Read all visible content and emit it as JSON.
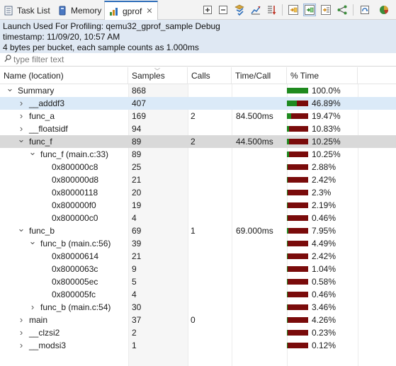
{
  "tabs": [
    {
      "label": "Task List",
      "icon": "task-list-icon",
      "active": false
    },
    {
      "label": "Memory",
      "icon": "memory-icon",
      "active": false
    },
    {
      "label": "gprof",
      "icon": "gprof-icon",
      "active": true
    }
  ],
  "toolbar": {
    "buttons": [
      "expand-all-icon",
      "collapse-all-icon",
      "filter-icon",
      "export-chart-icon",
      "sort-icon",
      "view-by-file-icon",
      "view-by-function-icon",
      "view-by-line-icon",
      "call-graph-icon",
      "switch-sample-icon",
      "chart-icon"
    ]
  },
  "info": {
    "line1": "Launch Used For Profiling: qemu32_gprof_sample Debug",
    "line2": "timestamp: 11/09/20, 10:57 AM",
    "line3": "4 bytes per bucket, each sample counts as 1.000ms"
  },
  "filter": {
    "placeholder": "type filter text"
  },
  "columns": {
    "name": "Name (location)",
    "samples": "Samples",
    "calls": "Calls",
    "time": "Time/Call",
    "pct": "% Time"
  },
  "colors": {
    "bar_green": "#1f8a1f",
    "bar_red": "#7a0b0b",
    "info_bg": "#dfe8f3"
  },
  "rows": [
    {
      "name": "Summary",
      "samples": "868",
      "calls": "",
      "time": "",
      "pct": "100.0%",
      "fraction": 1.0,
      "level": 0,
      "twisty": "open"
    },
    {
      "name": "__adddf3",
      "samples": "407",
      "calls": "",
      "time": "",
      "pct": "46.89%",
      "fraction": 0.4689,
      "level": 1,
      "twisty": "closed",
      "highlight": "blue"
    },
    {
      "name": "func_a",
      "samples": "169",
      "calls": "2",
      "time": "84.500ms",
      "pct": "19.47%",
      "fraction": 0.1947,
      "level": 1,
      "twisty": "closed"
    },
    {
      "name": "__floatsidf",
      "samples": "94",
      "calls": "",
      "time": "",
      "pct": "10.83%",
      "fraction": 0.1083,
      "level": 1,
      "twisty": "closed"
    },
    {
      "name": "func_f",
      "samples": "89",
      "calls": "2",
      "time": "44.500ms",
      "pct": "10.25%",
      "fraction": 0.1025,
      "level": 1,
      "twisty": "open",
      "highlight": "grey"
    },
    {
      "name": "func_f (main.c:33)",
      "samples": "89",
      "calls": "",
      "time": "",
      "pct": "10.25%",
      "fraction": 0.1025,
      "level": 2,
      "twisty": "open"
    },
    {
      "name": "0x800000c8",
      "samples": "25",
      "calls": "",
      "time": "",
      "pct": "2.88%",
      "fraction": 0.0288,
      "level": 3,
      "twisty": ""
    },
    {
      "name": "0x800000d8",
      "samples": "21",
      "calls": "",
      "time": "",
      "pct": "2.42%",
      "fraction": 0.0242,
      "level": 3,
      "twisty": ""
    },
    {
      "name": "0x80000118",
      "samples": "20",
      "calls": "",
      "time": "",
      "pct": "2.3%",
      "fraction": 0.023,
      "level": 3,
      "twisty": ""
    },
    {
      "name": "0x800000f0",
      "samples": "19",
      "calls": "",
      "time": "",
      "pct": "2.19%",
      "fraction": 0.0219,
      "level": 3,
      "twisty": ""
    },
    {
      "name": "0x800000c0",
      "samples": "4",
      "calls": "",
      "time": "",
      "pct": "0.46%",
      "fraction": 0.0046,
      "level": 3,
      "twisty": ""
    },
    {
      "name": "func_b",
      "samples": "69",
      "calls": "1",
      "time": "69.000ms",
      "pct": "7.95%",
      "fraction": 0.0795,
      "level": 1,
      "twisty": "open"
    },
    {
      "name": "func_b (main.c:56)",
      "samples": "39",
      "calls": "",
      "time": "",
      "pct": "4.49%",
      "fraction": 0.0449,
      "level": 2,
      "twisty": "open"
    },
    {
      "name": "0x80000614",
      "samples": "21",
      "calls": "",
      "time": "",
      "pct": "2.42%",
      "fraction": 0.0242,
      "level": 3,
      "twisty": ""
    },
    {
      "name": "0x8000063c",
      "samples": "9",
      "calls": "",
      "time": "",
      "pct": "1.04%",
      "fraction": 0.0104,
      "level": 3,
      "twisty": ""
    },
    {
      "name": "0x800005ec",
      "samples": "5",
      "calls": "",
      "time": "",
      "pct": "0.58%",
      "fraction": 0.0058,
      "level": 3,
      "twisty": ""
    },
    {
      "name": "0x800005fc",
      "samples": "4",
      "calls": "",
      "time": "",
      "pct": "0.46%",
      "fraction": 0.0046,
      "level": 3,
      "twisty": ""
    },
    {
      "name": "func_b (main.c:54)",
      "samples": "30",
      "calls": "",
      "time": "",
      "pct": "3.46%",
      "fraction": 0.0346,
      "level": 2,
      "twisty": "closed"
    },
    {
      "name": "main",
      "samples": "37",
      "calls": "0",
      "time": "",
      "pct": "4.26%",
      "fraction": 0.0426,
      "level": 1,
      "twisty": "closed"
    },
    {
      "name": "__clzsi2",
      "samples": "2",
      "calls": "",
      "time": "",
      "pct": "0.23%",
      "fraction": 0.0023,
      "level": 1,
      "twisty": "closed"
    },
    {
      "name": "__modsi3",
      "samples": "1",
      "calls": "",
      "time": "",
      "pct": "0.12%",
      "fraction": 0.0012,
      "level": 1,
      "twisty": "closed"
    }
  ]
}
